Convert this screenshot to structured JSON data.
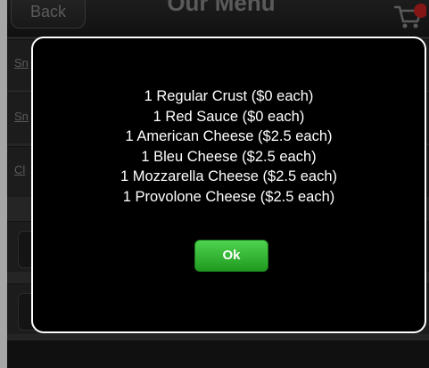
{
  "nav": {
    "back_label": "Back",
    "title": "Our Menu",
    "cart_icon": "cart-icon"
  },
  "list": {
    "items": [
      {
        "label": "Sn"
      },
      {
        "label": "Sn"
      },
      {
        "label": "Cl"
      }
    ]
  },
  "dialog": {
    "lines": [
      "1 Regular Crust ($0 each)",
      "1 Red Sauce ($0 each)",
      "1 American Cheese ($2.5 each)",
      "1 Bleu Cheese ($2.5 each)",
      "1 Mozzarella Cheese ($2.5 each)",
      "1 Provolone Cheese ($2.5 each)"
    ],
    "ok_label": "Ok"
  },
  "colors": {
    "ok_button": "#2fb52f",
    "dialog_bg": "#000000",
    "dialog_border": "#ffffff",
    "cart_badge": "#cc2222"
  }
}
